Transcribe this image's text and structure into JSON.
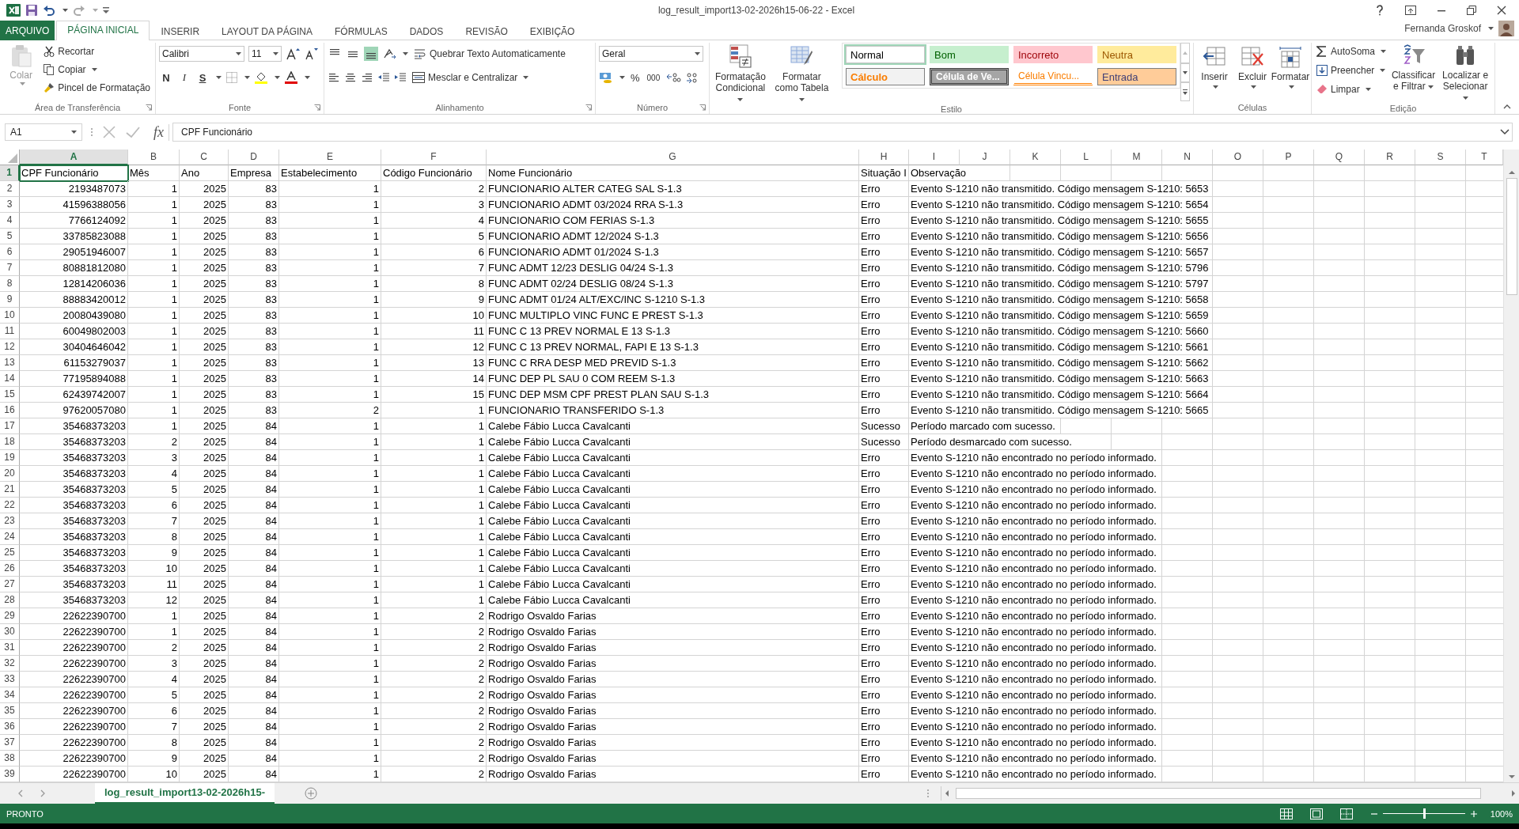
{
  "title_bar": {
    "title": "log_result_import13-02-2026h15-06-22 - Excel"
  },
  "tabs": [
    {
      "label": "ARQUIVO",
      "kind": "file",
      "selected": false
    },
    {
      "label": "PÁGINA INICIAL",
      "kind": "tab",
      "selected": true
    },
    {
      "label": "INSERIR",
      "kind": "tab",
      "selected": false
    },
    {
      "label": "LAYOUT DA PÁGINA",
      "kind": "tab",
      "selected": false
    },
    {
      "label": "FÓRMULAS",
      "kind": "tab",
      "selected": false
    },
    {
      "label": "DADOS",
      "kind": "tab",
      "selected": false
    },
    {
      "label": "REVISÃO",
      "kind": "tab",
      "selected": false
    },
    {
      "label": "EXIBIÇÃO",
      "kind": "tab",
      "selected": false
    }
  ],
  "user": {
    "name": "Fernanda Groskof"
  },
  "ribbon": {
    "clipboard": {
      "label": "Área de Transferência",
      "paste": "Colar",
      "paste_disabled": true,
      "cut": "Recortar",
      "copy": "Copiar",
      "painter": "Pincel de Formatação"
    },
    "font": {
      "label": "Fonte",
      "family": "Calibri",
      "size": "11",
      "bold": "N",
      "italic": "I",
      "underline": "S"
    },
    "alignment": {
      "label": "Alinhamento",
      "vertical_align": [
        {
          "kind": "top",
          "selected": false
        },
        {
          "kind": "middle",
          "selected": false
        },
        {
          "kind": "bottom",
          "selected": true
        }
      ],
      "wrap": "Quebrar Texto Automaticamente",
      "merge": "Mesclar e Centralizar"
    },
    "number": {
      "label": "Número",
      "format": "Geral",
      "percent": "%",
      "thousands": "000"
    },
    "styles": {
      "label": "Estilo",
      "conditional": "Formatação Condicional",
      "table": "Formatar como Tabela",
      "gallery": [
        {
          "label": "Normal",
          "kind": "normal",
          "selected": true
        },
        {
          "label": "Bom",
          "kind": "good",
          "selected": false
        },
        {
          "label": "Incorreto",
          "kind": "bad",
          "selected": false
        },
        {
          "label": "Neutra",
          "kind": "neutral",
          "selected": false
        },
        {
          "label": "Cálculo",
          "kind": "calculation",
          "selected": false
        },
        {
          "label": "Célula de Ve...",
          "kind": "check",
          "selected": false
        },
        {
          "label": "Célula Vincu...",
          "kind": "linked",
          "selected": false
        },
        {
          "label": "Entrada",
          "kind": "input",
          "selected": false
        }
      ]
    },
    "cells": {
      "label": "Células",
      "buttons": [
        {
          "label": "Inserir",
          "kind": "insert"
        },
        {
          "label": "Excluir",
          "kind": "delete"
        },
        {
          "label": "Formatar",
          "kind": "format"
        }
      ]
    },
    "editing": {
      "label": "Edição",
      "autosum": "AutoSoma",
      "fill": "Preencher",
      "clear": "Limpar",
      "sort": "Classificar e Filtrar",
      "find": "Localizar e Selecionar"
    }
  },
  "formula_bar": {
    "name_box": "A1",
    "function_label": "fx",
    "formula": "CPF Funcionário"
  },
  "sheet": {
    "columns": [
      {
        "label": "A",
        "numeric": true,
        "selected": true
      },
      {
        "label": "B",
        "numeric": true,
        "selected": false
      },
      {
        "label": "C",
        "numeric": true,
        "selected": false
      },
      {
        "label": "D",
        "numeric": true,
        "selected": false
      },
      {
        "label": "E",
        "numeric": true,
        "selected": false
      },
      {
        "label": "F",
        "numeric": true,
        "selected": false
      },
      {
        "label": "G",
        "selected": false
      },
      {
        "label": "H",
        "selected": false
      },
      {
        "label": "I",
        "selected": false
      },
      {
        "label": "J",
        "selected": false
      },
      {
        "label": "K",
        "selected": false
      },
      {
        "label": "L",
        "selected": false
      },
      {
        "label": "M",
        "selected": false
      },
      {
        "label": "N",
        "selected": false
      },
      {
        "label": "O",
        "selected": false
      },
      {
        "label": "P",
        "selected": false
      },
      {
        "label": "Q",
        "selected": false
      },
      {
        "label": "R",
        "selected": false
      },
      {
        "label": "S",
        "selected": false
      },
      {
        "label": "T",
        "selected": false
      }
    ],
    "header_row": {
      "number": "1",
      "selected": true,
      "cells": [
        "CPF Funcionário",
        "Mês",
        "Ano",
        "Empresa",
        "Estabelecimento",
        "Código Funcionário",
        "Nome Funcionário",
        "Situação I",
        "Observação"
      ]
    },
    "rows": [
      {
        "number": "2",
        "cells": [
          "2193487073",
          "1",
          "2025",
          "83",
          "1",
          "2",
          "FUNCIONARIO ALTER CATEG SAL  S-1.3",
          "Erro",
          "Evento S-1210 não transmitido. Código mensagem S-1210: 5653"
        ]
      },
      {
        "number": "3",
        "cells": [
          "41596388056",
          "1",
          "2025",
          "83",
          "1",
          "3",
          "FUNCIONARIO ADMT  03/2024 RRA S-1.3",
          "Erro",
          "Evento S-1210 não transmitido. Código mensagem S-1210: 5654"
        ]
      },
      {
        "number": "4",
        "cells": [
          "7766124092",
          "1",
          "2025",
          "83",
          "1",
          "4",
          "FUNCIONARIO COM FERIAS S-1.3",
          "Erro",
          "Evento S-1210 não transmitido. Código mensagem S-1210: 5655"
        ]
      },
      {
        "number": "5",
        "cells": [
          "33785823088",
          "1",
          "2025",
          "83",
          "1",
          "5",
          "FUNCIONARIO ADMT 12/2024  S-1.3",
          "Erro",
          "Evento S-1210 não transmitido. Código mensagem S-1210: 5656"
        ]
      },
      {
        "number": "6",
        "cells": [
          "29051946007",
          "1",
          "2025",
          "83",
          "1",
          "6",
          "FUNCIONARIO ADMT 01/2024  S-1.3",
          "Erro",
          "Evento S-1210 não transmitido. Código mensagem S-1210: 5657"
        ]
      },
      {
        "number": "7",
        "cells": [
          "80881812080",
          "1",
          "2025",
          "83",
          "1",
          "7",
          "FUNC ADMT 12/23 DESLIG 04/24  S-1.3",
          "Erro",
          "Evento S-1210 não transmitido. Código mensagem S-1210: 5796"
        ]
      },
      {
        "number": "8",
        "cells": [
          "12814206036",
          "1",
          "2025",
          "83",
          "1",
          "8",
          "FUNC ADMT 02/24 DESLIG 08/24  S-1.3",
          "Erro",
          "Evento S-1210 não transmitido. Código mensagem S-1210: 5797"
        ]
      },
      {
        "number": "9",
        "cells": [
          "88883420012",
          "1",
          "2025",
          "83",
          "1",
          "9",
          "FUNC ADMT 01/24 ALT/EXC/INC S-1210 S-1.3",
          "Erro",
          "Evento S-1210 não transmitido. Código mensagem S-1210: 5658"
        ]
      },
      {
        "number": "10",
        "cells": [
          "20080439080",
          "1",
          "2025",
          "83",
          "1",
          "10",
          "FUNC MULTIPLO VINC FUNC E PREST  S-1.3",
          "Erro",
          "Evento S-1210 não transmitido. Código mensagem S-1210: 5659"
        ]
      },
      {
        "number": "11",
        "cells": [
          "60049802003",
          "1",
          "2025",
          "83",
          "1",
          "11",
          "FUNC C 13 PREV NORMAL E 13  S-1.3",
          "Erro",
          "Evento S-1210 não transmitido. Código mensagem S-1210: 5660"
        ]
      },
      {
        "number": "12",
        "cells": [
          "30404646042",
          "1",
          "2025",
          "83",
          "1",
          "12",
          "FUNC C 13 PREV NORMAL, FAPI  E 13  S-1.3",
          "Erro",
          "Evento S-1210 não transmitido. Código mensagem S-1210: 5661"
        ]
      },
      {
        "number": "13",
        "cells": [
          "61153279037",
          "1",
          "2025",
          "83",
          "1",
          "13",
          "FUNC C RRA DESP MED PREVID  S-1.3",
          "Erro",
          "Evento S-1210 não transmitido. Código mensagem S-1210: 5662"
        ]
      },
      {
        "number": "14",
        "cells": [
          "77195894088",
          "1",
          "2025",
          "83",
          "1",
          "14",
          "FUNC DEP PL SAU 0 COM  REEM  S-1.3",
          "Erro",
          "Evento S-1210 não transmitido. Código mensagem S-1210: 5663"
        ]
      },
      {
        "number": "15",
        "cells": [
          "62439742007",
          "1",
          "2025",
          "83",
          "1",
          "15",
          "FUNC DEP MSM CPF PREST PLAN SAU  S-1.3",
          "Erro",
          "Evento S-1210 não transmitido. Código mensagem S-1210: 5664"
        ]
      },
      {
        "number": "16",
        "cells": [
          "97620057080",
          "1",
          "2025",
          "83",
          "2",
          "1",
          "FUNCIONARIO TRANSFERIDO S-1.3",
          "Erro",
          "Evento S-1210 não transmitido. Código mensagem S-1210: 5665"
        ]
      },
      {
        "number": "17",
        "cells": [
          "35468373203",
          "1",
          "2025",
          "84",
          "1",
          "1",
          "Calebe Fábio Lucca Cavalcanti",
          "Sucesso",
          "Período marcado com sucesso."
        ]
      },
      {
        "number": "18",
        "cells": [
          "35468373203",
          "2",
          "2025",
          "84",
          "1",
          "1",
          "Calebe Fábio Lucca Cavalcanti",
          "Sucesso",
          "Período desmarcado com sucesso."
        ]
      },
      {
        "number": "19",
        "cells": [
          "35468373203",
          "3",
          "2025",
          "84",
          "1",
          "1",
          "Calebe Fábio Lucca Cavalcanti",
          "Erro",
          "Evento S-1210 não encontrado no período informado."
        ]
      },
      {
        "number": "20",
        "cells": [
          "35468373203",
          "4",
          "2025",
          "84",
          "1",
          "1",
          "Calebe Fábio Lucca Cavalcanti",
          "Erro",
          "Evento S-1210 não encontrado no período informado."
        ]
      },
      {
        "number": "21",
        "cells": [
          "35468373203",
          "5",
          "2025",
          "84",
          "1",
          "1",
          "Calebe Fábio Lucca Cavalcanti",
          "Erro",
          "Evento S-1210 não encontrado no período informado."
        ]
      },
      {
        "number": "22",
        "cells": [
          "35468373203",
          "6",
          "2025",
          "84",
          "1",
          "1",
          "Calebe Fábio Lucca Cavalcanti",
          "Erro",
          "Evento S-1210 não encontrado no período informado."
        ]
      },
      {
        "number": "23",
        "cells": [
          "35468373203",
          "7",
          "2025",
          "84",
          "1",
          "1",
          "Calebe Fábio Lucca Cavalcanti",
          "Erro",
          "Evento S-1210 não encontrado no período informado."
        ]
      },
      {
        "number": "24",
        "cells": [
          "35468373203",
          "8",
          "2025",
          "84",
          "1",
          "1",
          "Calebe Fábio Lucca Cavalcanti",
          "Erro",
          "Evento S-1210 não encontrado no período informado."
        ]
      },
      {
        "number": "25",
        "cells": [
          "35468373203",
          "9",
          "2025",
          "84",
          "1",
          "1",
          "Calebe Fábio Lucca Cavalcanti",
          "Erro",
          "Evento S-1210 não encontrado no período informado."
        ]
      },
      {
        "number": "26",
        "cells": [
          "35468373203",
          "10",
          "2025",
          "84",
          "1",
          "1",
          "Calebe Fábio Lucca Cavalcanti",
          "Erro",
          "Evento S-1210 não encontrado no período informado."
        ]
      },
      {
        "number": "27",
        "cells": [
          "35468373203",
          "11",
          "2025",
          "84",
          "1",
          "1",
          "Calebe Fábio Lucca Cavalcanti",
          "Erro",
          "Evento S-1210 não encontrado no período informado."
        ]
      },
      {
        "number": "28",
        "cells": [
          "35468373203",
          "12",
          "2025",
          "84",
          "1",
          "1",
          "Calebe Fábio Lucca Cavalcanti",
          "Erro",
          "Evento S-1210 não encontrado no período informado."
        ]
      },
      {
        "number": "29",
        "cells": [
          "22622390700",
          "1",
          "2025",
          "84",
          "1",
          "2",
          "Rodrigo Osvaldo Farias",
          "Erro",
          "Evento S-1210 não encontrado no período informado."
        ]
      },
      {
        "number": "30",
        "cells": [
          "22622390700",
          "1",
          "2025",
          "84",
          "1",
          "2",
          "Rodrigo Osvaldo Farias",
          "Erro",
          "Evento S-1210 não encontrado no período informado."
        ]
      },
      {
        "number": "31",
        "cells": [
          "22622390700",
          "2",
          "2025",
          "84",
          "1",
          "2",
          "Rodrigo Osvaldo Farias",
          "Erro",
          "Evento S-1210 não encontrado no período informado."
        ]
      },
      {
        "number": "32",
        "cells": [
          "22622390700",
          "3",
          "2025",
          "84",
          "1",
          "2",
          "Rodrigo Osvaldo Farias",
          "Erro",
          "Evento S-1210 não encontrado no período informado."
        ]
      },
      {
        "number": "33",
        "cells": [
          "22622390700",
          "4",
          "2025",
          "84",
          "1",
          "2",
          "Rodrigo Osvaldo Farias",
          "Erro",
          "Evento S-1210 não encontrado no período informado."
        ]
      },
      {
        "number": "34",
        "cells": [
          "22622390700",
          "5",
          "2025",
          "84",
          "1",
          "2",
          "Rodrigo Osvaldo Farias",
          "Erro",
          "Evento S-1210 não encontrado no período informado."
        ]
      },
      {
        "number": "35",
        "cells": [
          "22622390700",
          "6",
          "2025",
          "84",
          "1",
          "2",
          "Rodrigo Osvaldo Farias",
          "Erro",
          "Evento S-1210 não encontrado no período informado."
        ]
      },
      {
        "number": "36",
        "cells": [
          "22622390700",
          "7",
          "2025",
          "84",
          "1",
          "2",
          "Rodrigo Osvaldo Farias",
          "Erro",
          "Evento S-1210 não encontrado no período informado."
        ]
      },
      {
        "number": "37",
        "cells": [
          "22622390700",
          "8",
          "2025",
          "84",
          "1",
          "2",
          "Rodrigo Osvaldo Farias",
          "Erro",
          "Evento S-1210 não encontrado no período informado."
        ]
      },
      {
        "number": "38",
        "cells": [
          "22622390700",
          "9",
          "2025",
          "84",
          "1",
          "2",
          "Rodrigo Osvaldo Farias",
          "Erro",
          "Evento S-1210 não encontrado no período informado."
        ]
      },
      {
        "number": "39",
        "cells": [
          "22622390700",
          "10",
          "2025",
          "84",
          "1",
          "2",
          "Rodrigo Osvaldo Farias",
          "Erro",
          "Evento S-1210 não encontrado no período informado."
        ]
      }
    ]
  },
  "sheet_tabs": [
    {
      "label": "log_result_import13-02-2026h15-",
      "selected": true
    }
  ],
  "status_bar": {
    "status": "PRONTO",
    "zoom": "100%",
    "zoom_slider": {
      "level": 0.5
    }
  }
}
